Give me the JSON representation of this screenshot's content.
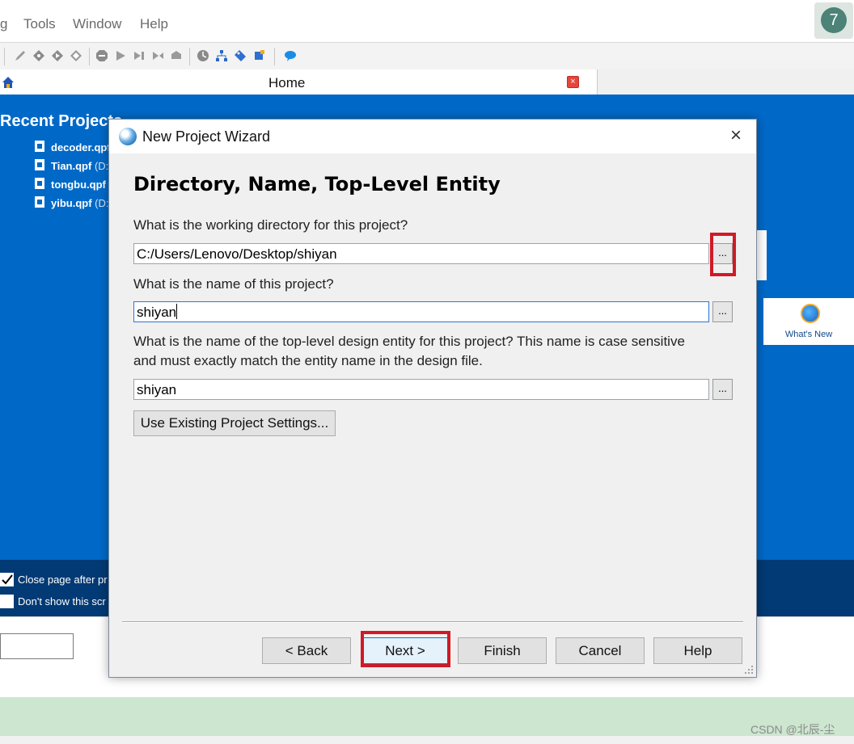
{
  "menubar": {
    "items": [
      "g",
      "Tools",
      "Window",
      "Help"
    ]
  },
  "badge": {
    "number": "7"
  },
  "toolbar": {
    "icons": [
      "pencil-icon",
      "diamond-icon",
      "diamond-play-icon",
      "diamond-grid-icon",
      "stop-icon",
      "play-icon",
      "step-icon",
      "step-into-icon",
      "step-out-icon",
      "clock-icon",
      "hierarchy-icon",
      "tag-icon",
      "chip-icon",
      "chat-icon"
    ]
  },
  "home_tab": {
    "title": "Home"
  },
  "recent": {
    "title": "Recent Projects",
    "items": [
      {
        "name": "decoder.qpf",
        "path": ""
      },
      {
        "name": "Tian.qpf",
        "path": "(D:"
      },
      {
        "name": "tongbu.qpf",
        "path": ""
      },
      {
        "name": "yibu.qpf",
        "path": "(D:"
      }
    ]
  },
  "whats_new": {
    "label": "What's New"
  },
  "options": {
    "close_page": {
      "label": "Close page after pr",
      "checked": true
    },
    "dont_show": {
      "label": "Don't show this scr",
      "checked": false
    }
  },
  "dialog": {
    "title": "New Project Wizard",
    "heading": "Directory, Name, Top-Level Entity",
    "q_directory": "What is the working directory for this project?",
    "directory_value": "C:/Users/Lenovo/Desktop/shiyan",
    "q_name": "What is the name of this project?",
    "name_value": "shiyan",
    "q_entity_line1": "What is the name of the top-level design entity for this project? This name is case sensitive",
    "q_entity_line2": "and must exactly match the entity name in the design file.",
    "entity_value": "shiyan",
    "browse_label": "...",
    "use_existing": "Use Existing Project Settings...",
    "buttons": {
      "back": "< Back",
      "next": "Next >",
      "finish": "Finish",
      "cancel": "Cancel",
      "help": "Help"
    }
  },
  "watermark": "CSDN @北辰-尘"
}
